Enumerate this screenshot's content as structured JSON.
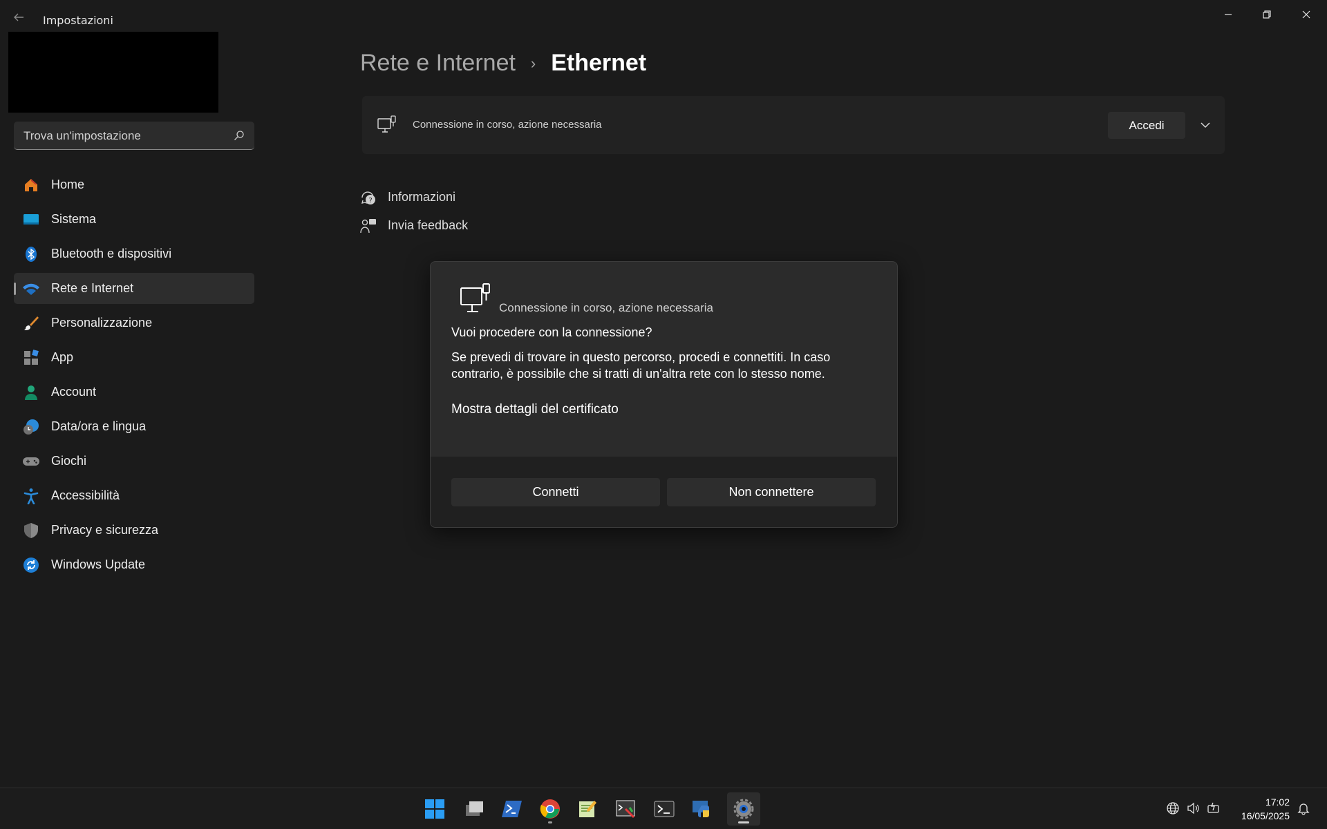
{
  "window": {
    "title": "Impostazioni"
  },
  "search": {
    "placeholder": "Trova un'impostazione"
  },
  "sidebar": {
    "items": [
      {
        "label": "Home",
        "icon": "home-icon"
      },
      {
        "label": "Sistema",
        "icon": "system-icon"
      },
      {
        "label": "Bluetooth e dispositivi",
        "icon": "bluetooth-icon"
      },
      {
        "label": "Rete e Internet",
        "icon": "wifi-icon",
        "selected": true
      },
      {
        "label": "Personalizzazione",
        "icon": "brush-icon"
      },
      {
        "label": "App",
        "icon": "apps-icon"
      },
      {
        "label": "Account",
        "icon": "account-icon"
      },
      {
        "label": "Data/ora e lingua",
        "icon": "time-language-icon"
      },
      {
        "label": "Giochi",
        "icon": "gamepad-icon"
      },
      {
        "label": "Accessibilità",
        "icon": "accessibility-icon"
      },
      {
        "label": "Privacy e sicurezza",
        "icon": "shield-icon"
      },
      {
        "label": "Windows Update",
        "icon": "update-icon"
      }
    ]
  },
  "breadcrumb": {
    "parent": "Rete e Internet",
    "separator": "›",
    "current": "Ethernet"
  },
  "status_card": {
    "text": "Connessione in corso, azione necessaria",
    "button": "Accedi"
  },
  "links": [
    {
      "label": "Informazioni",
      "icon": "help-icon"
    },
    {
      "label": "Invia feedback",
      "icon": "feedback-icon"
    }
  ],
  "dialog": {
    "caption": "Connessione in corso, azione necessaria",
    "question": "Vuoi procedere con la connessione?",
    "body": "Se prevedi di trovare  in questo percorso, procedi e connettiti. In caso contrario, è possibile che si tratti di un'altra rete con lo stesso nome.",
    "details_link": "Mostra dettagli del certificato",
    "connect": "Connetti",
    "dont_connect": "Non connettere"
  },
  "taskbar": {
    "apps": [
      "start-icon",
      "file-explorer-icon",
      "powershell-icon",
      "chrome-icon",
      "notepad-icon",
      "snipping-tool-icon",
      "terminal-icon",
      "python-icon",
      "settings-icon"
    ],
    "time": "17:02",
    "date": "16/05/2025"
  },
  "colors": {
    "background": "#1b1b1b",
    "card": "#222222",
    "dialog": "#2b2b2b",
    "accent": "#0078d4"
  }
}
